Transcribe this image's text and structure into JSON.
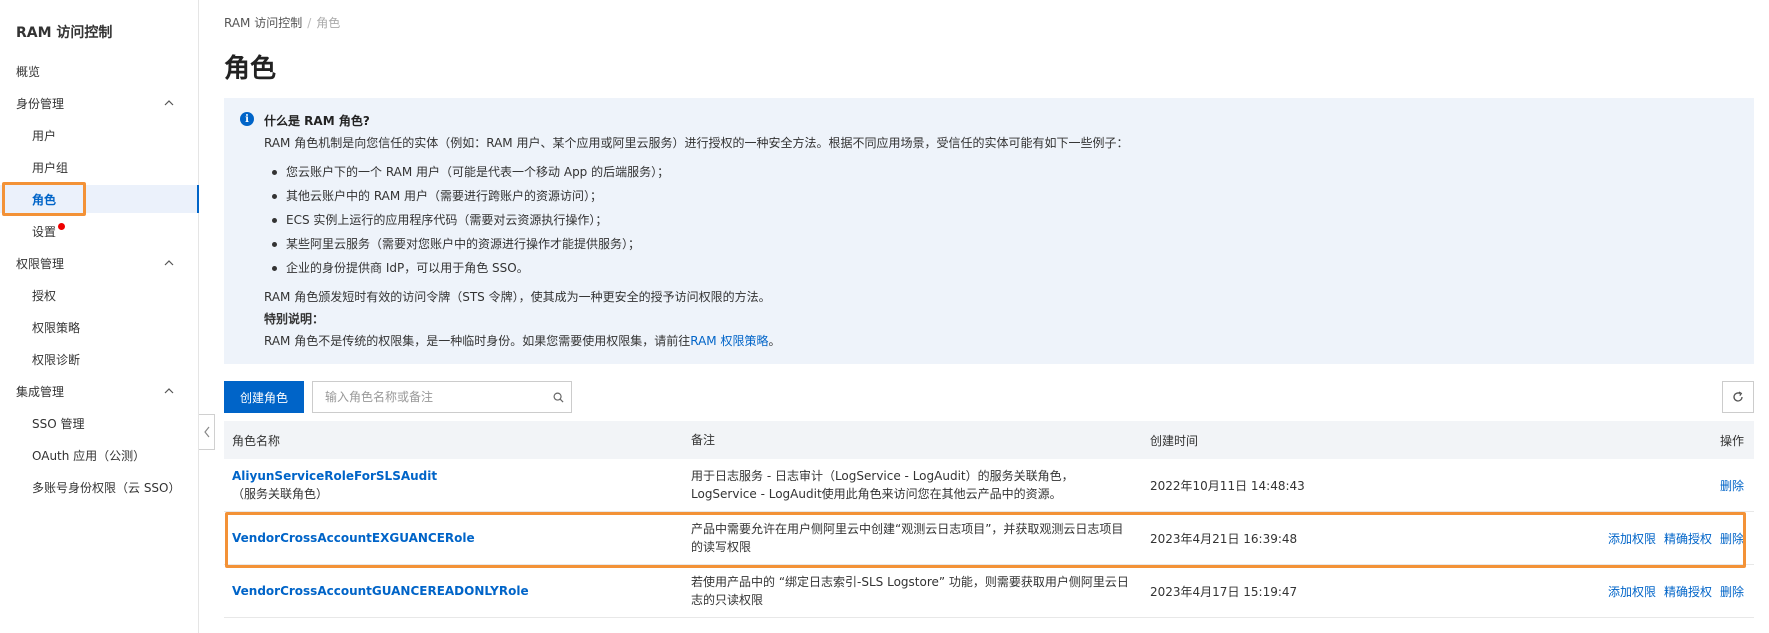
{
  "sidebar": {
    "title": "RAM 访问控制",
    "items": [
      {
        "label": "概览"
      },
      {
        "label": "身份管理"
      },
      {
        "label": "用户"
      },
      {
        "label": "用户组"
      },
      {
        "label": "角色"
      },
      {
        "label": "设置"
      },
      {
        "label": "权限管理"
      },
      {
        "label": "授权"
      },
      {
        "label": "权限策略"
      },
      {
        "label": "权限诊断"
      },
      {
        "label": "集成管理"
      },
      {
        "label": "SSO 管理"
      },
      {
        "label": "OAuth 应用（公测）"
      },
      {
        "label": "多账号身份权限（云 SSO）"
      }
    ]
  },
  "breadcrumb": {
    "root": "RAM 访问控制",
    "separator": "/",
    "current": "角色"
  },
  "page": {
    "title": "角色"
  },
  "info": {
    "title": "什么是 RAM 角色?",
    "intro": "RAM 角色机制是向您信任的实体（例如：RAM 用户、某个应用或阿里云服务）进行授权的一种安全方法。根据不同应用场景，受信任的实体可能有如下一些例子：",
    "bullets": [
      "您云账户下的一个 RAM 用户（可能是代表一个移动 App 的后端服务）；",
      "其他云账户中的 RAM 用户（需要进行跨账户的资源访问）；",
      "ECS 实例上运行的应用程序代码（需要对云资源执行操作）；",
      "某些阿里云服务（需要对您账户中的资源进行操作才能提供服务）；",
      "企业的身份提供商 IdP，可以用于角色 SSO。"
    ],
    "sts": "RAM 角色颁发短时有效的访问令牌（STS 令牌），使其成为一种更安全的授予访问权限的方法。",
    "special_title": "特别说明：",
    "special_text": "RAM 角色不是传统的权限集，是一种临时身份。如果您需要使用权限集，请前往",
    "special_link": "RAM 权限策略",
    "special_end": "。"
  },
  "toolbar": {
    "create_label": "创建角色",
    "search_placeholder": "输入角色名称或备注"
  },
  "table": {
    "columns": [
      "角色名称",
      "备注",
      "创建时间",
      "操作"
    ],
    "rows": [
      {
        "name": "AliyunServiceRoleForSLSAudit",
        "sub": "（服务关联角色）",
        "note": "用于日志服务 - 日志审计（LogService - LogAudit）的服务关联角色，LogService - LogAudit使用此角色来访问您在其他云产品中的资源。",
        "created": "2022年10月11日 14:48:43",
        "actions": [
          "删除"
        ]
      },
      {
        "name": "VendorCrossAccountEXGUANCERole",
        "sub": "",
        "note": "产品中需要允许在用户侧阿里云中创建“观测云日志项目”，并获取观测云日志项目的读写权限",
        "created": "2023年4月21日 16:39:48",
        "actions": [
          "添加权限",
          "精确授权",
          "删除"
        ]
      },
      {
        "name": "VendorCrossAccountGUANCEREADONLYRole",
        "sub": "",
        "note": "若使用产品中的 “绑定日志索引-SLS Logstore” 功能，则需要获取用户侧阿里云日志的只读权限",
        "created": "2023年4月17日 15:19:47",
        "actions": [
          "添加权限",
          "精确授权",
          "删除"
        ]
      }
    ]
  },
  "colors": {
    "accent": "#0064c8",
    "highlight": "#f39237",
    "notice_dot": "#e00000",
    "info_bg": "#eef3fa"
  }
}
